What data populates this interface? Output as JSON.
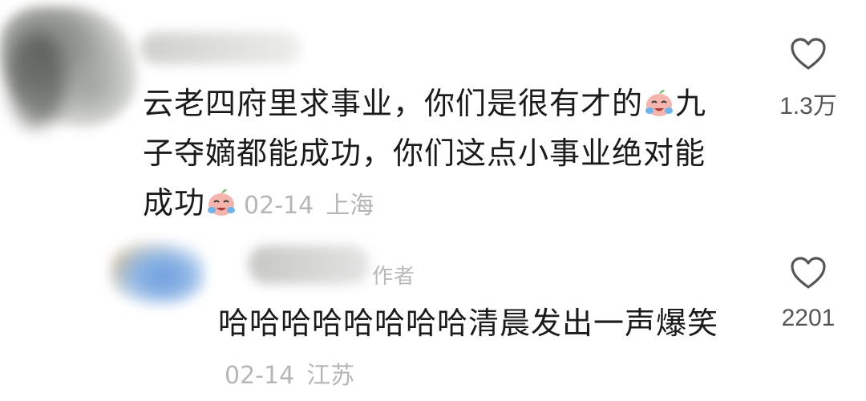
{
  "comments": [
    {
      "text_part1": "云老四府里求事业，你们是很有才的",
      "text_part2": "九子夺嫡都能成功，你们这点小事业绝对能成功",
      "date": "02-14",
      "location": "上海",
      "likes": "1.3万",
      "emoji": "crying-laughing-peach-emoji"
    },
    {
      "badge": "作者",
      "text": "哈哈哈哈哈哈哈哈清晨发出一声爆笑",
      "date": "02-14",
      "location": "江苏",
      "likes": "2201"
    }
  ],
  "icons": {
    "like": "heart-outline-icon"
  },
  "colors": {
    "text": "#1b1b1b",
    "meta": "#b6b6b6",
    "like_count": "#555555"
  }
}
